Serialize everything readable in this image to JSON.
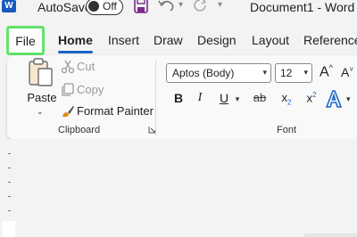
{
  "titlebar": {
    "app_logo_letter": "W",
    "autosave_label": "AutoSave",
    "autosave_state": "Off",
    "document_title": "Document1 - Word"
  },
  "tabs": [
    {
      "label": "File"
    },
    {
      "label": "Home"
    },
    {
      "label": "Insert"
    },
    {
      "label": "Draw"
    },
    {
      "label": "Design"
    },
    {
      "label": "Layout"
    },
    {
      "label": "References"
    }
  ],
  "clipboard": {
    "paste_label": "Paste",
    "cut_label": "Cut",
    "copy_label": "Copy",
    "format_painter_label": "Format Painter",
    "group_label": "Clipboard"
  },
  "font": {
    "font_name": "Aptos (Body)",
    "font_size": "12",
    "grow_label": "A",
    "shrink_label": "A",
    "bold": "B",
    "italic": "I",
    "underline": "U",
    "strike": "ab",
    "subscript_base": "x",
    "subscript_mark": "2",
    "superscript_base": "x",
    "superscript_mark": "2",
    "group_label": "Font"
  },
  "colors": {
    "accent": "#1a66c5",
    "file_highlight": "#63e36b",
    "save_icon": "#7a2a8a"
  },
  "icons": [
    "word-logo-icon",
    "save-icon",
    "undo-icon",
    "redo-icon",
    "clipboard-paste-icon",
    "scissors-icon",
    "copy-icon",
    "paintbrush-icon",
    "dialog-launcher-icon",
    "text-effects-icon"
  ]
}
